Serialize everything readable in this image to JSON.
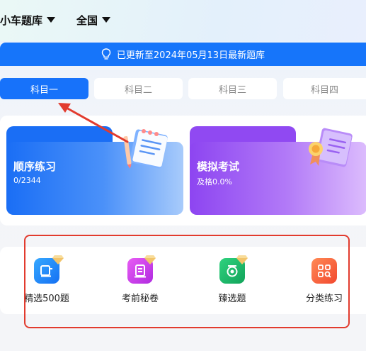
{
  "header": {
    "vehicle_selector": "小车题库",
    "region_selector": "全国"
  },
  "banner": {
    "text": "已更新至2024年05月13日最新题库"
  },
  "subject_tabs": [
    {
      "label": "科目一",
      "active": true
    },
    {
      "label": "科目二",
      "active": false
    },
    {
      "label": "科目三",
      "active": false
    },
    {
      "label": "科目四",
      "active": false
    }
  ],
  "cards": {
    "sequential": {
      "title": "顺序练习",
      "subtitle": "0/2344"
    },
    "mock_exam": {
      "title": "模拟考试",
      "subtitle": "及格0.0%"
    }
  },
  "tools": [
    {
      "label": "精选500题",
      "icon": "book-icon",
      "color": "#1b8df6"
    },
    {
      "label": "考前秘卷",
      "icon": "document-icon",
      "color": "#c23ee8"
    },
    {
      "label": "臻选题",
      "icon": "badge-icon",
      "color": "#19b56a"
    },
    {
      "label": "分类练习",
      "icon": "category-icon",
      "color": "#f65a3a"
    }
  ],
  "colors": {
    "accent": "#1675fa",
    "annotation": "#e23b2e"
  }
}
